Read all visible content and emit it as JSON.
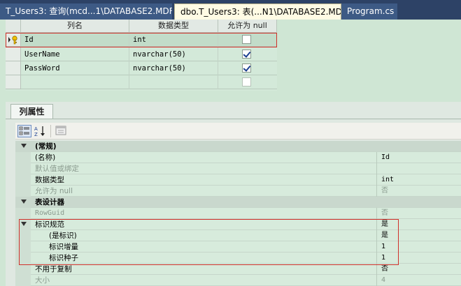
{
  "tabs": [
    {
      "label": "T_Users3: 查询(mcd...1\\DATABASE2.MDF)",
      "active": false
    },
    {
      "label": "dbo.T_Users3: 表(...N1\\DATABASE2.MDF)",
      "active": true
    },
    {
      "label": "Program.cs",
      "active": false
    }
  ],
  "grid": {
    "headers": [
      "列名",
      "数据类型",
      "允许为 null"
    ],
    "rows": [
      {
        "name": "Id",
        "type": "int",
        "allow_null": false,
        "primary_key": true
      },
      {
        "name": "UserName",
        "type": "nvarchar(50)",
        "allow_null": true
      },
      {
        "name": "PassWord",
        "type": "nvarchar(50)",
        "allow_null": true
      },
      {
        "name": "",
        "type": "",
        "allow_null": false
      }
    ]
  },
  "properties_panel": {
    "tab_label": "列属性",
    "rows": [
      {
        "kind": "category",
        "name": "(常规)",
        "value": ""
      },
      {
        "kind": "prop",
        "name": "(名称)",
        "value": "Id",
        "dim": false
      },
      {
        "kind": "prop",
        "name": "默认值或绑定",
        "value": "",
        "dim": true
      },
      {
        "kind": "prop",
        "name": "数据类型",
        "value": "int",
        "dim": false
      },
      {
        "kind": "prop",
        "name": "允许为 null",
        "value": "否",
        "dim": true
      },
      {
        "kind": "category",
        "name": "表设计器",
        "value": ""
      },
      {
        "kind": "prop",
        "name": "RowGuid",
        "value": "否",
        "dim": true
      },
      {
        "kind": "expand",
        "name": "标识规范",
        "value": "是",
        "dim": false
      },
      {
        "kind": "sub",
        "name": "(是标识)",
        "value": "是",
        "dim": false
      },
      {
        "kind": "sub",
        "name": "标识增量",
        "value": "1",
        "dim": false
      },
      {
        "kind": "sub",
        "name": "标识种子",
        "value": "1",
        "dim": false
      },
      {
        "kind": "prop",
        "name": "不用于复制",
        "value": "否",
        "dim": false
      },
      {
        "kind": "prop",
        "name": "大小",
        "value": "4",
        "dim": true
      }
    ]
  },
  "icons": {
    "primary_key": "key-icon",
    "categorized": "categorized-icon",
    "alphabetical": "sort-alpha-icon",
    "property_pages": "property-pages-icon"
  },
  "colors": {
    "tab_bar": "#2d4266",
    "active_tab": "#fffbe4",
    "highlight_box": "#d0302a",
    "background": "#cfe6d4"
  }
}
